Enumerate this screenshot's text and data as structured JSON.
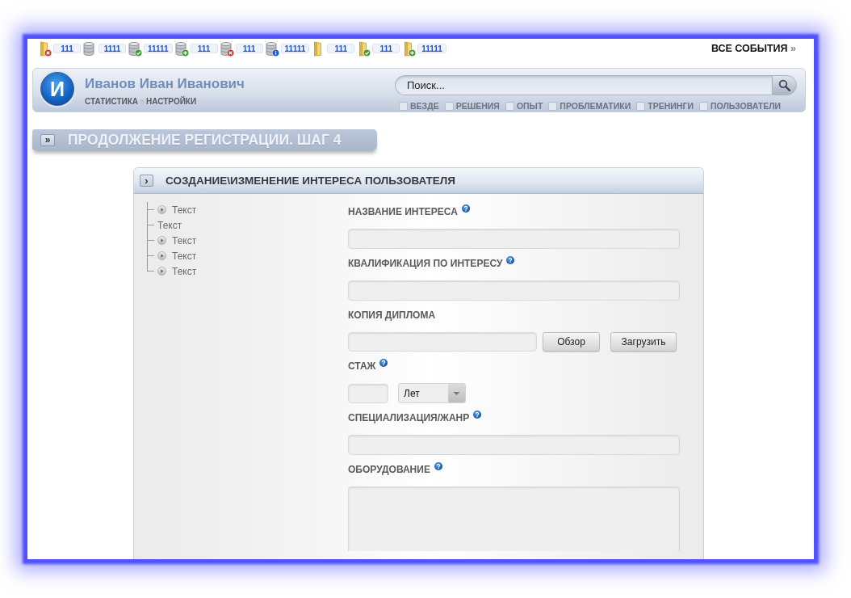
{
  "top_bar": {
    "counters": [
      {
        "kind": "folder-cross",
        "count": "111"
      },
      {
        "kind": "database",
        "count": "1111"
      },
      {
        "kind": "database-check",
        "count": "11111"
      },
      {
        "kind": "database-plus",
        "count": "111"
      },
      {
        "kind": "database-cross",
        "count": "111"
      },
      {
        "kind": "database-info",
        "count": "11111"
      },
      {
        "kind": "folder",
        "count": "111"
      },
      {
        "kind": "folder-check",
        "count": "111"
      },
      {
        "kind": "folder-plus",
        "count": "11111"
      }
    ],
    "all_events": {
      "label": "ВСЕ СОБЫТИЯ",
      "arrow": "»"
    }
  },
  "header": {
    "avatar_initial": "И",
    "user_name": "Иванов Иван Иванович",
    "links": [
      "СТАТИСТИКА",
      "НАСТРОЙКИ"
    ],
    "search": {
      "placeholder": "Поиск...",
      "filters": [
        {
          "label": "ВЕЗДЕ",
          "checked": false
        },
        {
          "label": "РЕШЕНИЯ",
          "checked": false
        },
        {
          "label": "ОПЫТ",
          "checked": false
        },
        {
          "label": "ПРОБЛЕМАТИКИ",
          "checked": false
        },
        {
          "label": "ТРЕНИНГИ",
          "checked": false
        },
        {
          "label": "ПОЛЬЗОВАТЕЛИ",
          "checked": false
        }
      ]
    }
  },
  "page_title": {
    "toggle": "»",
    "text": "ПРОДОЛЖЕНИЕ РЕГИСТРАЦИИ. ШАГ 4"
  },
  "panel": {
    "toggle": "›",
    "title": "СОЗДАНИЕ\\ИЗМЕНЕНИЕ ИНТЕРЕСА ПОЛЬЗОВАТЕЛЯ",
    "tree": [
      {
        "label": "Текст",
        "expandable": true
      },
      {
        "label": "Текст",
        "expandable": false
      },
      {
        "label": "Текст",
        "expandable": true
      },
      {
        "label": "Текст",
        "expandable": true
      },
      {
        "label": "Текст",
        "expandable": true
      }
    ],
    "form": [
      {
        "kind": "text",
        "label": "НАЗВАНИЕ ИНТЕРЕСА",
        "help": true
      },
      {
        "kind": "text",
        "label": "КВАЛИФИКАЦИЯ ПО ИНТЕРЕСУ",
        "help": true
      },
      {
        "kind": "file",
        "label": "КОПИЯ ДИПЛОМА",
        "help": false,
        "buttons": [
          "Обзор",
          "Загрузить"
        ]
      },
      {
        "kind": "duration",
        "label": "СТАЖ",
        "help": true,
        "unit": "Лет"
      },
      {
        "kind": "text",
        "label": "СПЕЦИАЛИЗАЦИЯ/ЖАНР",
        "help": true
      },
      {
        "kind": "textarea",
        "label": "ОБОРУДОВАНИЕ",
        "help": true
      }
    ]
  }
}
